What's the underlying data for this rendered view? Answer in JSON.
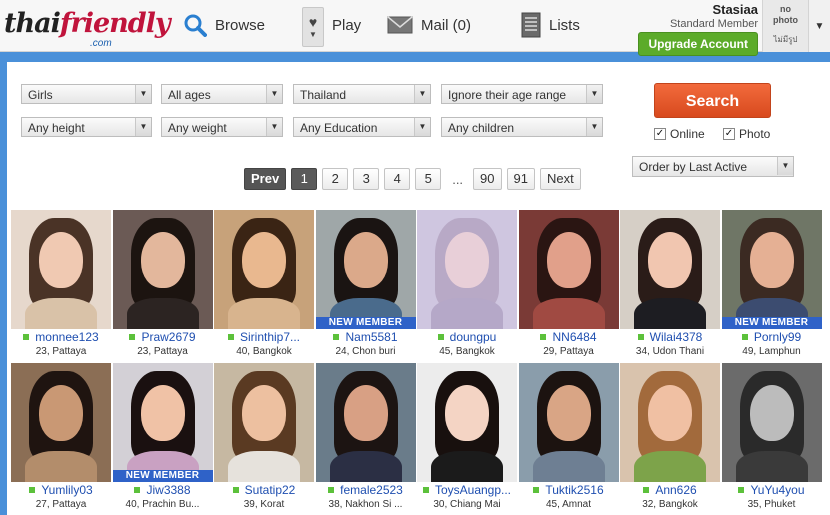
{
  "header": {
    "logo_thai": "thai",
    "logo_friendly": "friendly",
    "logo_com": ".com",
    "nav": {
      "browse": "Browse",
      "play": "Play",
      "mail": "Mail (0)",
      "lists": "Lists"
    },
    "user": {
      "name": "Stasiaa",
      "membership": "Standard Member",
      "upgrade": "Upgrade Account",
      "avatar_no_photo_1": "no",
      "avatar_no_photo_2": "photo",
      "avatar_no_photo_3": "ไม่มีรูป"
    }
  },
  "filters": {
    "gender": "Girls",
    "ages": "All ages",
    "country": "Thailand",
    "age_range": "Ignore their age range",
    "height": "Any height",
    "weight": "Any weight",
    "education": "Any Education",
    "children": "Any children",
    "search": "Search",
    "online_label": "Online",
    "photo_label": "Photo",
    "order": "Order by Last Active"
  },
  "pagination": {
    "prev": "Prev",
    "pages": [
      "1",
      "2",
      "3",
      "4",
      "5"
    ],
    "ellipsis": "...",
    "last_pages": [
      "90",
      "91"
    ],
    "next": "Next"
  },
  "profiles": [
    {
      "name": "monnee123",
      "loc": "23, Pattaya",
      "new": false,
      "skin": "#f0c9b2",
      "hair": "#4a3326",
      "bg": "#e6d8cc",
      "top": "#d9c2a8"
    },
    {
      "name": "Praw2679",
      "loc": "23, Pattaya",
      "new": false,
      "skin": "#e3b79c",
      "hair": "#1c1410",
      "bg": "#6b5a55",
      "top": "#2c2422"
    },
    {
      "name": "Sirinthip7...",
      "loc": "40, Bangkok",
      "new": false,
      "skin": "#e9b88f",
      "hair": "#3a2414",
      "bg": "#c7a27a",
      "top": "#d8b48e"
    },
    {
      "name": "Nam5581",
      "loc": "24, Chon buri",
      "new": true,
      "skin": "#dba98a",
      "hair": "#1a1412",
      "bg": "#9fa7a8",
      "top": "#4a6b8c"
    },
    {
      "name": "doungpu",
      "loc": "45, Bangkok",
      "new": false,
      "skin": "#e8cfd8",
      "hair": "#b8a9c6",
      "bg": "#cfc6e0",
      "top": "#b5a8c8"
    },
    {
      "name": "NN6484",
      "loc": "29, Pattaya",
      "new": false,
      "skin": "#e1a08a",
      "hair": "#2a1512",
      "bg": "#7a3a36",
      "top": "#a04a42"
    },
    {
      "name": "Wilai4378",
      "loc": "34, Udon Thani",
      "new": false,
      "skin": "#f1c6b0",
      "hair": "#2a1c18",
      "bg": "#d6cfc6",
      "top": "#1d1d22"
    },
    {
      "name": "Pornly99",
      "loc": "49, Lamphun",
      "new": true,
      "skin": "#e5b094",
      "hair": "#3b2a22",
      "bg": "#6f7666",
      "top": "#3c4c70"
    },
    {
      "name": "Yumlily03",
      "loc": "27, Pattaya",
      "new": false,
      "skin": "#c99874",
      "hair": "#1f1410",
      "bg": "#8b6e55",
      "top": "#b38d6b"
    },
    {
      "name": "Jiw3388",
      "loc": "40, Prachin Bu...",
      "new": true,
      "skin": "#f0c2a6",
      "hair": "#1a1010",
      "bg": "#d3d0d6",
      "top": "#c9a1c2"
    },
    {
      "name": "Sutatip22",
      "loc": "39, Korat",
      "new": false,
      "skin": "#edc0a0",
      "hair": "#5a3a22",
      "bg": "#c6b8a2",
      "top": "#e6e2dc"
    },
    {
      "name": "female2523",
      "loc": "38, Nakhon Si ...",
      "new": false,
      "skin": "#d8a084",
      "hair": "#1c1412",
      "bg": "#6a7c8a",
      "top": "#2b2f44"
    },
    {
      "name": "ToysAuangp...",
      "loc": "30, Chiang Mai",
      "new": false,
      "skin": "#f4d4c4",
      "hair": "#18100e",
      "bg": "#ececec",
      "top": "#1b1b1b"
    },
    {
      "name": "Tuktik2516",
      "loc": "45, Amnat",
      "new": false,
      "skin": "#d9a585",
      "hair": "#1c1310",
      "bg": "#8a9dab",
      "top": "#6e7f93"
    },
    {
      "name": "Ann626",
      "loc": "32, Bangkok",
      "new": false,
      "skin": "#f0c0a3",
      "hair": "#a26a3c",
      "bg": "#d9c3ad",
      "top": "#7da34a"
    },
    {
      "name": "YuYu4you",
      "loc": "35, Phuket",
      "new": false,
      "skin": "#bcbcbc",
      "hair": "#2a2a2a",
      "bg": "#6b6b6b",
      "top": "#3a3a3a"
    }
  ],
  "colors": {
    "page_bg": "#4a90d9",
    "link": "#1f4fb0",
    "online_dot": "#5cc13b",
    "new_badge": "#2f62c8",
    "search_btn": "#e45a2a",
    "upgrade_btn": "#5cab2a"
  },
  "icons": [
    "search-icon",
    "heart-icon",
    "mail-icon",
    "list-icon",
    "chevron-down-icon"
  ]
}
